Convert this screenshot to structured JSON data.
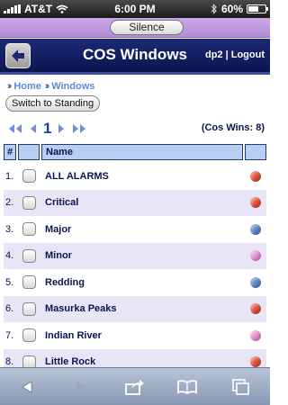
{
  "status_bar": {
    "carrier": "AT&T",
    "time": "6:00 PM",
    "battery": "60%",
    "battery_level": 0.6
  },
  "silence": {
    "label": "Silence"
  },
  "header": {
    "title": "COS Windows",
    "user": "dp2 | Logout"
  },
  "breadcrumb": {
    "items": [
      "Home",
      "Windows"
    ]
  },
  "switch_button": {
    "label": "Switch to Standing"
  },
  "pager": {
    "current_page": "1",
    "wins": "(Cos Wins: 8)"
  },
  "table": {
    "headers": {
      "num": "#",
      "name": "Name"
    },
    "rows": [
      {
        "num": "1.",
        "name": "ALL ALARMS",
        "status": "red"
      },
      {
        "num": "2.",
        "name": "Critical",
        "status": "red"
      },
      {
        "num": "3.",
        "name": "Major",
        "status": "blue"
      },
      {
        "num": "4.",
        "name": "Minor",
        "status": "pink"
      },
      {
        "num": "5.",
        "name": "Redding",
        "status": "blue"
      },
      {
        "num": "6.",
        "name": "Masurka Peaks",
        "status": "red"
      },
      {
        "num": "7.",
        "name": "Indian River",
        "status": "pink"
      },
      {
        "num": "8.",
        "name": "Little Rock",
        "status": "red"
      }
    ]
  },
  "colors": {
    "red": "#e8503a",
    "blue": "#5a87cf",
    "pink": "#ec8fd8",
    "header": "#1c2a76",
    "silence_bar": "#c9a9e6"
  },
  "toolbar": {
    "icons": [
      "back-arrow-icon",
      "forward-arrow-icon",
      "share-icon",
      "bookmarks-icon",
      "tabs-icon"
    ]
  }
}
